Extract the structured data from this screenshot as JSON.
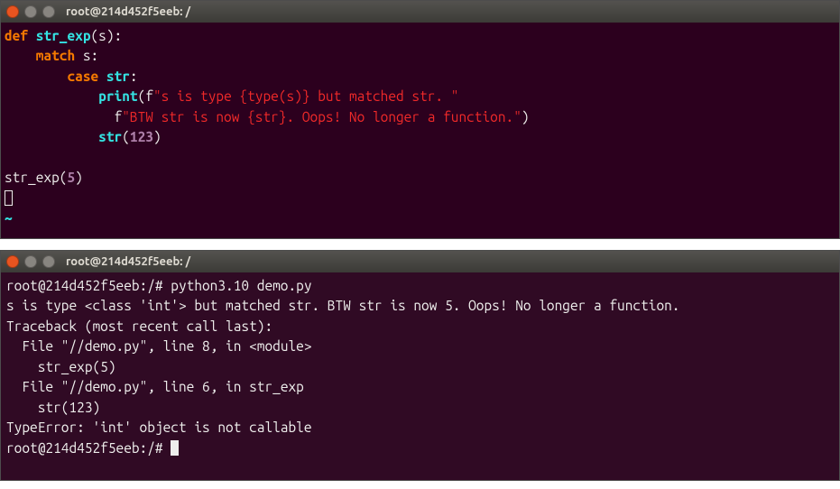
{
  "window1": {
    "title": "root@214d452f5eeb: /",
    "code": {
      "l1": {
        "def": "def",
        "fn": "str_exp",
        "rest": "(s):"
      },
      "l2": {
        "match": "match",
        "rest": " s:"
      },
      "l3": {
        "case": "case",
        "str": "str",
        "rest": ":"
      },
      "l4": {
        "print": "print",
        "open": "(f",
        "s1": "\"s is type {type(s)} but matched str. \""
      },
      "l5": {
        "pre": "              f",
        "s2": "\"BTW str is now {str}. Oops! No longer a function.\"",
        "close": ")"
      },
      "l6": {
        "str": "str",
        "open": "(",
        "num": "123",
        "close": ")"
      },
      "l7": {
        "call": "str_exp(",
        "arg": "5",
        "close": ")"
      },
      "tilde": "~"
    }
  },
  "window2": {
    "title": "root@214d452f5eeb: /",
    "output": {
      "l1": "root@214d452f5eeb:/# python3.10 demo.py",
      "l2": "s is type <class 'int'> but matched str. BTW str is now 5. Oops! No longer a function.",
      "l3": "Traceback (most recent call last):",
      "l4": "  File \"//demo.py\", line 8, in <module>",
      "l5": "    str_exp(5)",
      "l6": "  File \"//demo.py\", line 6, in str_exp",
      "l7": "    str(123)",
      "l8": "TypeError: 'int' object is not callable",
      "l9": "root@214d452f5eeb:/# "
    }
  }
}
